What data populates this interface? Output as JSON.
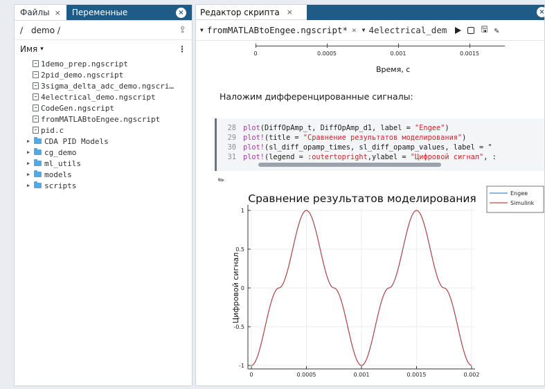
{
  "left_panel": {
    "tab_files": "Файлы",
    "tab_files_close": "×",
    "tab_variables": "Переменные",
    "tab_close_all": "×",
    "path_slash": "/",
    "path": "demo /",
    "list_header": "Имя",
    "list_sort": "▾",
    "more": "⋮",
    "files": [
      "1demo_prep.ngscript",
      "2pid_demo.ngscript",
      "3sigma_delta_adc_demo.ngscri…",
      "4electrical_demo.ngscript",
      "CodeGen.ngscript",
      "fromMATLABtoEngee.ngscript",
      "pid.c"
    ],
    "folders": [
      "CDA PID Models",
      "cg_demo",
      "ml_utils",
      "models",
      "scripts"
    ]
  },
  "editor": {
    "tab_title": "Редактор скрипта",
    "tab_close": "×",
    "close_all": "×",
    "file_tab_1": "fromMATLABtoEngee.ngscript*",
    "file_tab_1_close": "×",
    "file_tab_2": "4electrical_dem",
    "upper_chart": {
      "ticks": [
        "0",
        "0.0005",
        "0.001",
        "0.0015"
      ],
      "xlabel": "Время, с"
    },
    "markdown_text": "Наложим дифференцированные сигналы:",
    "code_lines": [
      {
        "n": "28",
        "parts": [
          [
            "fn",
            "plot"
          ],
          [
            "p",
            "(DiffOpAmp_t, DiffOpAmp_d1, label = "
          ],
          [
            "st",
            "\"Engee\""
          ],
          [
            "p",
            ")"
          ]
        ]
      },
      {
        "n": "29",
        "parts": [
          [
            "fn",
            "plot!"
          ],
          [
            "p",
            "(title = "
          ],
          [
            "st",
            "\"Сравнение результатов моделирования\""
          ],
          [
            "p",
            ")"
          ]
        ]
      },
      {
        "n": "30",
        "parts": [
          [
            "fn",
            "plot!"
          ],
          [
            "p",
            "(sl_diff_opamp_times, sl_diff_opamp_values, label = \""
          ]
        ]
      },
      {
        "n": "31",
        "parts": [
          [
            "fn",
            "plot!"
          ],
          [
            "p",
            "(legend = "
          ],
          [
            "sy",
            ":outertopright"
          ],
          [
            "p",
            ",ylabel = "
          ],
          [
            "st",
            "\"Цифровой сигнал\""
          ],
          [
            "p",
            ", :"
          ]
        ]
      }
    ]
  },
  "chart_data": {
    "type": "line",
    "title": "Сравнение результатов моделирования",
    "ylabel": "Цифровой сигнал",
    "xlabel": "",
    "xlim": [
      0,
      0.002
    ],
    "ylim": [
      -1,
      1
    ],
    "x_ticks": [
      "0",
      "0.0005",
      "0.001",
      "0.0015",
      "0.002"
    ],
    "y_ticks": [
      "-1",
      "-0.5",
      "0",
      "0.5",
      "1"
    ],
    "legend_placement": "outer-top-right",
    "grid": true,
    "series": [
      {
        "name": "Engee",
        "color": "#3a8fd6",
        "x": [
          0,
          0.00025,
          0.0005,
          0.00075,
          0.001,
          0.00125,
          0.0015,
          0.00175,
          0.002
        ],
        "values": [
          -1,
          0,
          1,
          0,
          -1,
          0,
          1,
          0,
          -1
        ]
      },
      {
        "name": "Simulink",
        "color": "#c4473d",
        "x": [
          0,
          0.00025,
          0.0005,
          0.00075,
          0.001,
          0.00125,
          0.0015,
          0.00175,
          0.002
        ],
        "values": [
          -1,
          0,
          1,
          0,
          -1,
          0,
          1,
          0,
          -1
        ]
      }
    ]
  }
}
